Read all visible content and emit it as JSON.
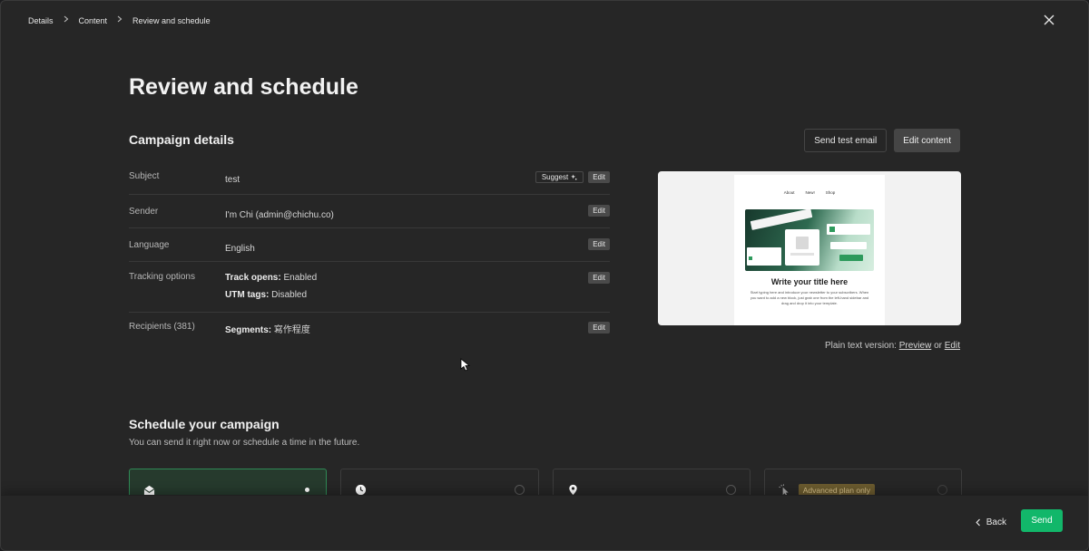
{
  "breadcrumb": [
    {
      "label": "Details"
    },
    {
      "label": "Content"
    },
    {
      "label": "Review and schedule"
    }
  ],
  "page_title": "Review and schedule",
  "campaign": {
    "title": "Campaign details",
    "send_test_label": "Send test email",
    "edit_content_label": "Edit content",
    "rows": [
      {
        "label": "Subject",
        "value": "test",
        "suggest": "Suggest",
        "edit": "Edit"
      },
      {
        "label": "Sender",
        "value": "I'm Chi (admin@chichu.co)",
        "edit": "Edit"
      },
      {
        "label": "Language",
        "value": "English",
        "edit": "Edit"
      },
      {
        "label": "Tracking options",
        "line1_key": "Track opens:",
        "line1_val": " Enabled",
        "line2_key": "UTM tags:",
        "line2_val": " Disabled",
        "edit": "Edit"
      },
      {
        "label": "Recipients (381)",
        "key": "Segments:",
        "val": " 寫作程度",
        "edit": "Edit"
      }
    ]
  },
  "preview": {
    "nav": [
      "About",
      "New!",
      "Shop"
    ],
    "mail_title": "Write your title here",
    "mail_body": "Start typing here and introduce your newsletter to your subscribers. When you want to add a new block, just grab one from the left-hand sidebar and drag and drop it into your template."
  },
  "plain_text": {
    "prefix": "Plain text version: ",
    "preview_link": "Preview",
    "or": " or ",
    "edit_link": "Edit"
  },
  "schedule": {
    "title": "Schedule your campaign",
    "subtitle": "You can send it right now or schedule a time in the future.",
    "options": [
      {
        "icon": "envelope-open-icon",
        "selected": true
      },
      {
        "icon": "clock-icon",
        "selected": false
      },
      {
        "icon": "location-pin-icon",
        "selected": false
      },
      {
        "icon": "click-cursor-icon",
        "selected": false,
        "badge": "Advanced plan only"
      }
    ]
  },
  "footer": {
    "back_label": "Back",
    "send_label": "Send"
  },
  "colors": {
    "background": "#262626",
    "accent": "#12b76a",
    "selected_border": "#2f8a55",
    "badge_bg": "#6a5a2e"
  }
}
